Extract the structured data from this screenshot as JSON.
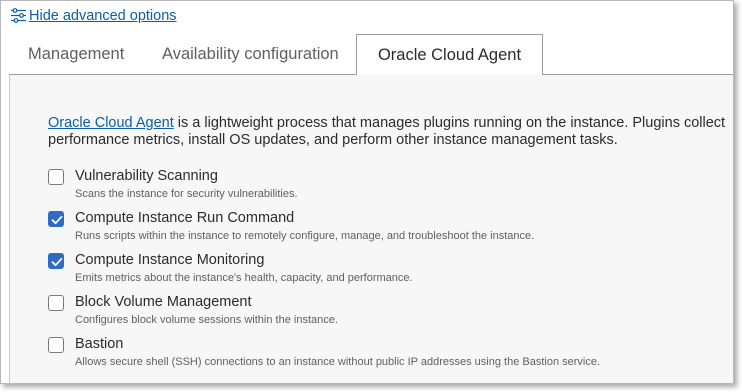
{
  "advanced": {
    "label": "Hide advanced options",
    "icon": "sliders-icon"
  },
  "tabs": [
    {
      "label": "Management",
      "active": false
    },
    {
      "label": "Availability configuration",
      "active": false
    },
    {
      "label": "Oracle Cloud Agent",
      "active": true
    }
  ],
  "intro": {
    "link_text": "Oracle Cloud Agent",
    "text": " is a lightweight process that manages plugins running on the instance. Plugins collect performance metrics, install OS updates, and perform other instance management tasks."
  },
  "plugins": [
    {
      "name": "Vulnerability Scanning",
      "description": "Scans the instance for security vulnerabilities.",
      "checked": false
    },
    {
      "name": "Compute Instance Run Command",
      "description": "Runs scripts within the instance to remotely configure, manage, and troubleshoot the instance.",
      "checked": true
    },
    {
      "name": "Compute Instance Monitoring",
      "description": "Emits metrics about the instance's health, capacity, and performance.",
      "checked": true
    },
    {
      "name": "Block Volume Management",
      "description": "Configures block volume sessions within the instance.",
      "checked": false
    },
    {
      "name": "Bastion",
      "description": "Allows secure shell (SSH) connections to an instance without public IP addresses using the Bastion service.",
      "checked": false
    }
  ],
  "colors": {
    "link": "#0a5fa8",
    "checkbox_checked": "#2f6bc4",
    "panel_bg": "#f7f7f7"
  }
}
